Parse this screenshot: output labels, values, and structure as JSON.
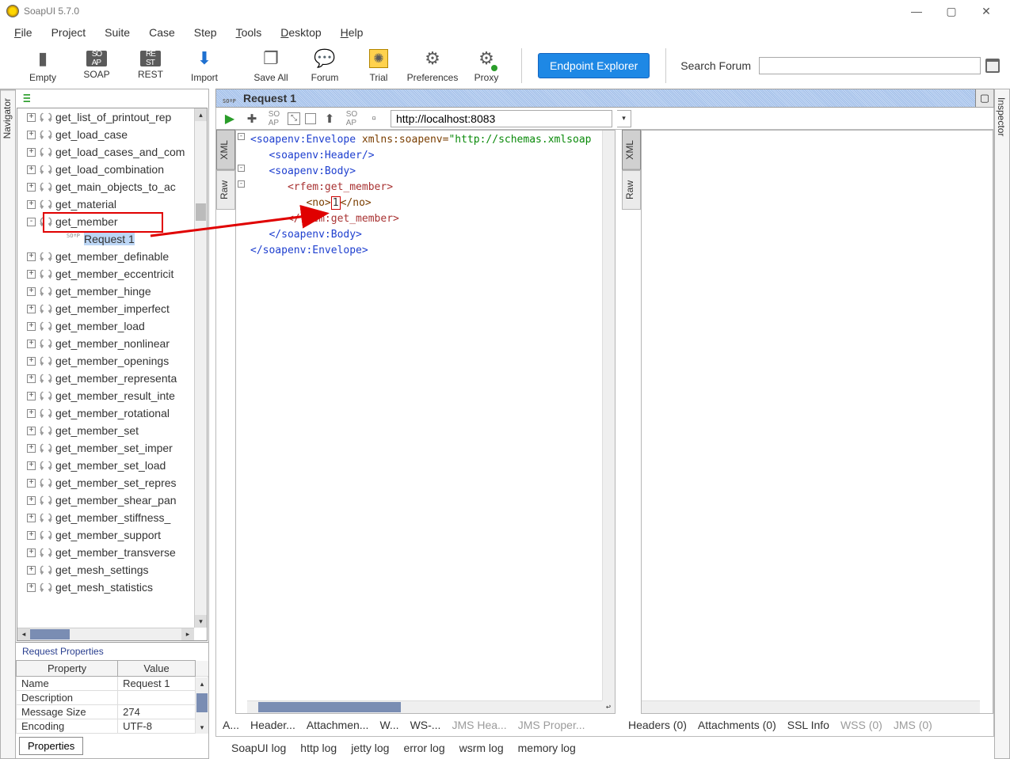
{
  "app": {
    "title": "SoapUI 5.7.0"
  },
  "menu": {
    "file": "File",
    "project": "Project",
    "suite": "Suite",
    "case": "Case",
    "step": "Step",
    "tools": "Tools",
    "desktop": "Desktop",
    "help": "Help"
  },
  "toolbar": {
    "empty": "Empty",
    "soap": "SOAP",
    "rest": "REST",
    "import": "Import",
    "save_all": "Save All",
    "forum": "Forum",
    "trial": "Trial",
    "preferences": "Preferences",
    "proxy": "Proxy",
    "endpoint_explorer": "Endpoint Explorer",
    "search_forum_label": "Search Forum"
  },
  "sidebar": {
    "navigator_tab": "Navigator",
    "inspector_tab": "Inspector"
  },
  "navigator": {
    "items": [
      "get_list_of_printout_rep",
      "get_load_case",
      "get_load_cases_and_com",
      "get_load_combination",
      "get_main_objects_to_ac",
      "get_material",
      "get_member",
      "Request 1",
      "get_member_definable",
      "get_member_eccentricit",
      "get_member_hinge",
      "get_member_imperfect",
      "get_member_load",
      "get_member_nonlinear",
      "get_member_openings",
      "get_member_representa",
      "get_member_result_inte",
      "get_member_rotational",
      "get_member_set",
      "get_member_set_imper",
      "get_member_set_load",
      "get_member_set_repres",
      "get_member_shear_pan",
      "get_member_stiffness_",
      "get_member_support",
      "get_member_transverse",
      "get_mesh_settings",
      "get_mesh_statistics"
    ],
    "child_index": 7,
    "highlight_index": 6
  },
  "request_properties": {
    "title": "Request Properties",
    "col_property": "Property",
    "col_value": "Value",
    "rows": [
      {
        "p": "Name",
        "v": "Request 1"
      },
      {
        "p": "Description",
        "v": ""
      },
      {
        "p": "Message Size",
        "v": "274"
      },
      {
        "p": "Encoding",
        "v": "UTF-8"
      }
    ],
    "button": "Properties"
  },
  "editor": {
    "tab_title": "Request 1",
    "url": "http://localhost:8083",
    "pane_tabs": {
      "xml": "XML",
      "raw": "Raw"
    },
    "bottom_left": [
      "A...",
      "Header...",
      "Attachmen...",
      "W...",
      "WS-..."
    ],
    "bottom_left_grey": [
      "JMS Hea...",
      "JMS Proper..."
    ],
    "bottom_right": [
      "Headers (0)",
      "Attachments (0)",
      "SSL Info"
    ],
    "bottom_right_grey": [
      "WSS (0)",
      "JMS (0)"
    ],
    "xml": {
      "l1a": "<soapenv:Envelope",
      "l1b": " xmlns:soapenv=",
      "l1c": "\"http://schemas.xmlsoap",
      "l2": "<soapenv:Header/>",
      "l3": "<soapenv:Body>",
      "l4": "<rfem:get_member>",
      "l5a": "<no>",
      "l5b": "1",
      "l5c": "</no>",
      "l6": "</rfem:get_member>",
      "l7": "</soapenv:Body>",
      "l8": "</soapenv:Envelope>"
    }
  },
  "logs": [
    "SoapUI log",
    "http log",
    "jetty log",
    "error log",
    "wsrm log",
    "memory log"
  ]
}
